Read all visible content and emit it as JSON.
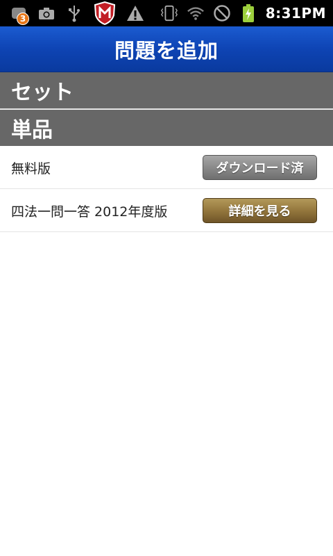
{
  "status_bar": {
    "notification_count": "3",
    "time": "8:31PM"
  },
  "header": {
    "title": "問題を追加"
  },
  "sections": {
    "set_label": "セット",
    "single_label": "単品"
  },
  "items": [
    {
      "label": "無料版",
      "button_label": "ダウンロード済"
    },
    {
      "label": "四法一問一答 2012年度版",
      "button_label": "詳細を見る"
    }
  ]
}
